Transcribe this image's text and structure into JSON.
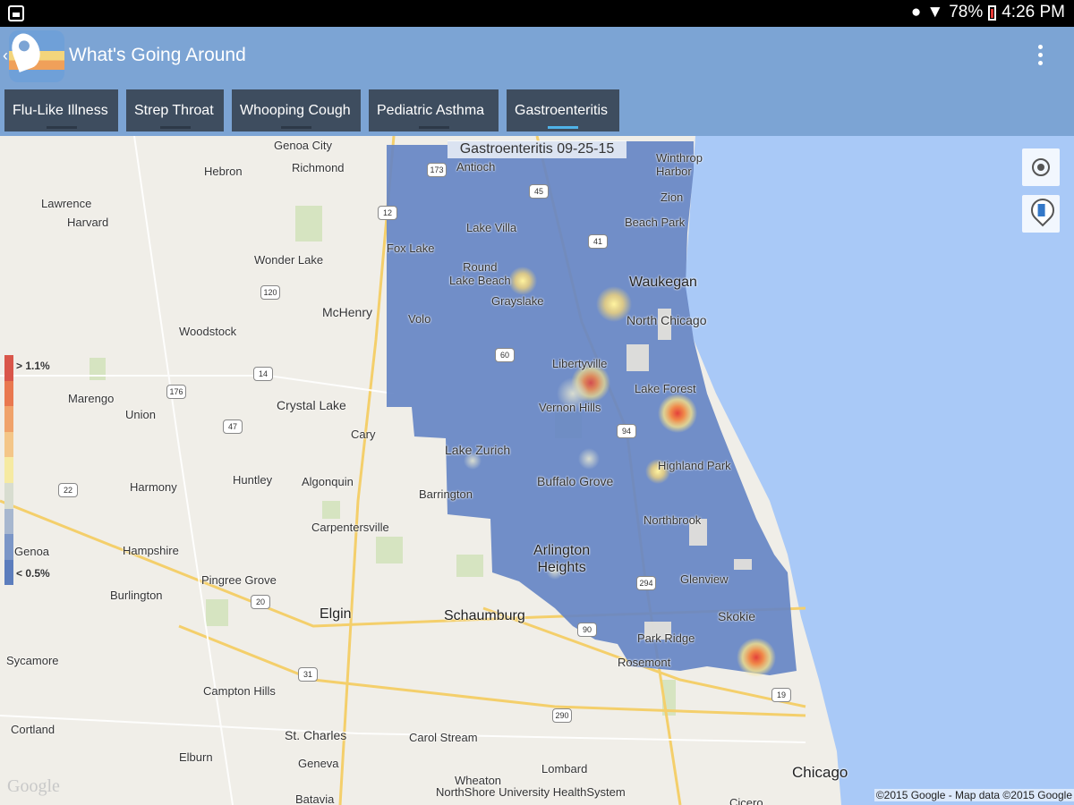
{
  "status_bar": {
    "battery": "78%",
    "time": "4:26 PM"
  },
  "app": {
    "title": "What's Going Around"
  },
  "tabs": [
    {
      "label": "Flu-Like Illness",
      "active": false
    },
    {
      "label": "Strep Throat",
      "active": false
    },
    {
      "label": "Whooping Cough",
      "active": false
    },
    {
      "label": "Pediatric Asthma",
      "active": false
    },
    {
      "label": "Gastroenteritis",
      "active": true
    }
  ],
  "map": {
    "title": "Gastroenteritis 09-25-15",
    "legend": {
      "high": "> 1.1%",
      "low": "< 0.5%",
      "colors": [
        "#d9564a",
        "#e9784f",
        "#f0a26a",
        "#f4c688",
        "#f6eaa2",
        "#d8ddd0",
        "#a7b7cf",
        "#7b96c7",
        "#5c7dbd"
      ]
    },
    "places": [
      "Genoa City",
      "Antioch",
      "Winthrop Harbor",
      "Hebron",
      "Richmond",
      "Zion",
      "Lawrence",
      "Harvard",
      "Lake Villa",
      "Beach Park",
      "Fox Lake",
      "Wonder Lake",
      "Round Lake Beach",
      "Waukegan",
      "Grayslake",
      "McHenry",
      "Volo",
      "North Chicago",
      "Woodstock",
      "Libertyville",
      "Marengo",
      "Lake Forest",
      "Union",
      "Crystal Lake",
      "Vernon Hills",
      "Cary",
      "Lake Zurich",
      "Highland Park",
      "Harmony",
      "Huntley",
      "Algonquin",
      "Barrington",
      "Buffalo Grove",
      "Northbrook",
      "Carpentersville",
      "Hampshire",
      "Genoa",
      "Arlington Heights",
      "Pingree Grove",
      "Glenview",
      "Burlington",
      "Elgin",
      "Schaumburg",
      "Skokie",
      "Park Ridge",
      "Sycamore",
      "Rosemont",
      "Campton Hills",
      "Cortland",
      "St. Charles",
      "Carol Stream",
      "Elburn",
      "Geneva",
      "Lombard",
      "Chicago",
      "Wheaton",
      "Batavia",
      "Cicero"
    ],
    "routes": [
      "173",
      "45",
      "12",
      "41",
      "120",
      "60",
      "14",
      "176",
      "47",
      "94",
      "22",
      "20",
      "90",
      "294",
      "31",
      "290",
      "19"
    ],
    "credit": "NorthShore University HealthSystem",
    "copyright": "©2015 Google - Map data ©2015 Google",
    "google_logo": "Google"
  }
}
